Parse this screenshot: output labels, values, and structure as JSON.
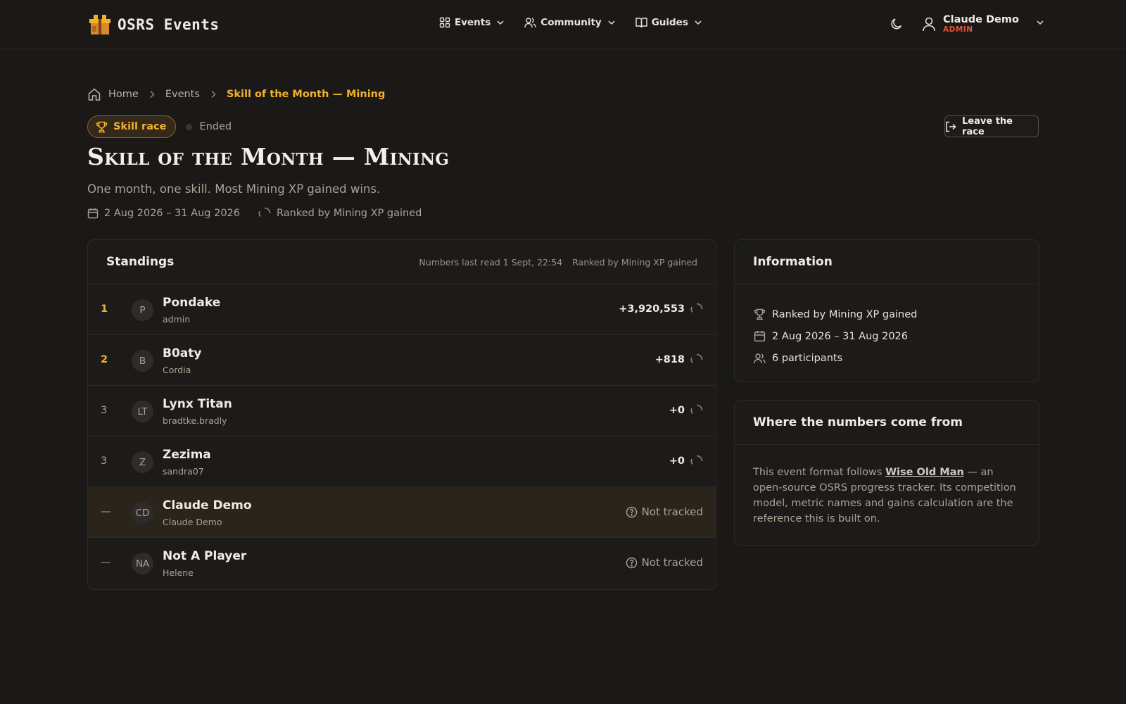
{
  "header": {
    "brand": "OSRS Events",
    "nav": [
      {
        "label": "Events"
      },
      {
        "label": "Community"
      },
      {
        "label": "Guides"
      }
    ],
    "user": {
      "name": "Claude Demo",
      "role": "ADMIN"
    }
  },
  "breadcrumb": {
    "home": "Home",
    "events": "Events",
    "current": "Skill of the Month — Mining"
  },
  "event": {
    "type_badge": "Skill race",
    "status": "Ended",
    "leave_label": "Leave the race",
    "title": "Skill of the Month — Mining",
    "description": "One month, one skill. Most Mining XP gained wins.",
    "dates": "2 Aug 2026 – 31 Aug 2026",
    "ranked_by": "Ranked by Mining XP gained"
  },
  "standings": {
    "title": "Standings",
    "last_read": "Numbers last read 1 Sept, 22:54",
    "ranked_by": "Ranked by Mining XP gained",
    "rows": [
      {
        "rank": "1",
        "initials": "P",
        "name": "Pondake",
        "user": "admin",
        "score": "+3,920,553"
      },
      {
        "rank": "2",
        "initials": "B",
        "name": "B0aty",
        "user": "Cordia",
        "score": "+818"
      },
      {
        "rank": "3",
        "initials": "LT",
        "name": "Lynx Titan",
        "user": "bradtke.bradly",
        "score": "+0"
      },
      {
        "rank": "3",
        "initials": "Z",
        "name": "Zezima",
        "user": "sandra07",
        "score": "+0"
      },
      {
        "rank": "—",
        "initials": "CD",
        "name": "Claude Demo",
        "user": "Claude Demo",
        "score": "Not tracked"
      },
      {
        "rank": "—",
        "initials": "NA",
        "name": "Not A Player",
        "user": "Helene",
        "score": "Not tracked"
      }
    ]
  },
  "info": {
    "title": "Information",
    "ranked_by": "Ranked by Mining XP gained",
    "dates": "2 Aug 2026 – 31 Aug 2026",
    "participants": "6 participants"
  },
  "source": {
    "title": "Where the numbers come from",
    "text_before": "This event format follows ",
    "link": "Wise Old Man",
    "text_after": " — an open-source OSRS progress tracker. Its competition model, metric names and gains calculation are the reference this is built on."
  },
  "colors": {
    "background": "#1a1918",
    "accent": "#f2b12a",
    "admin": "#e0563a",
    "highlight_row": "#2a241a"
  }
}
